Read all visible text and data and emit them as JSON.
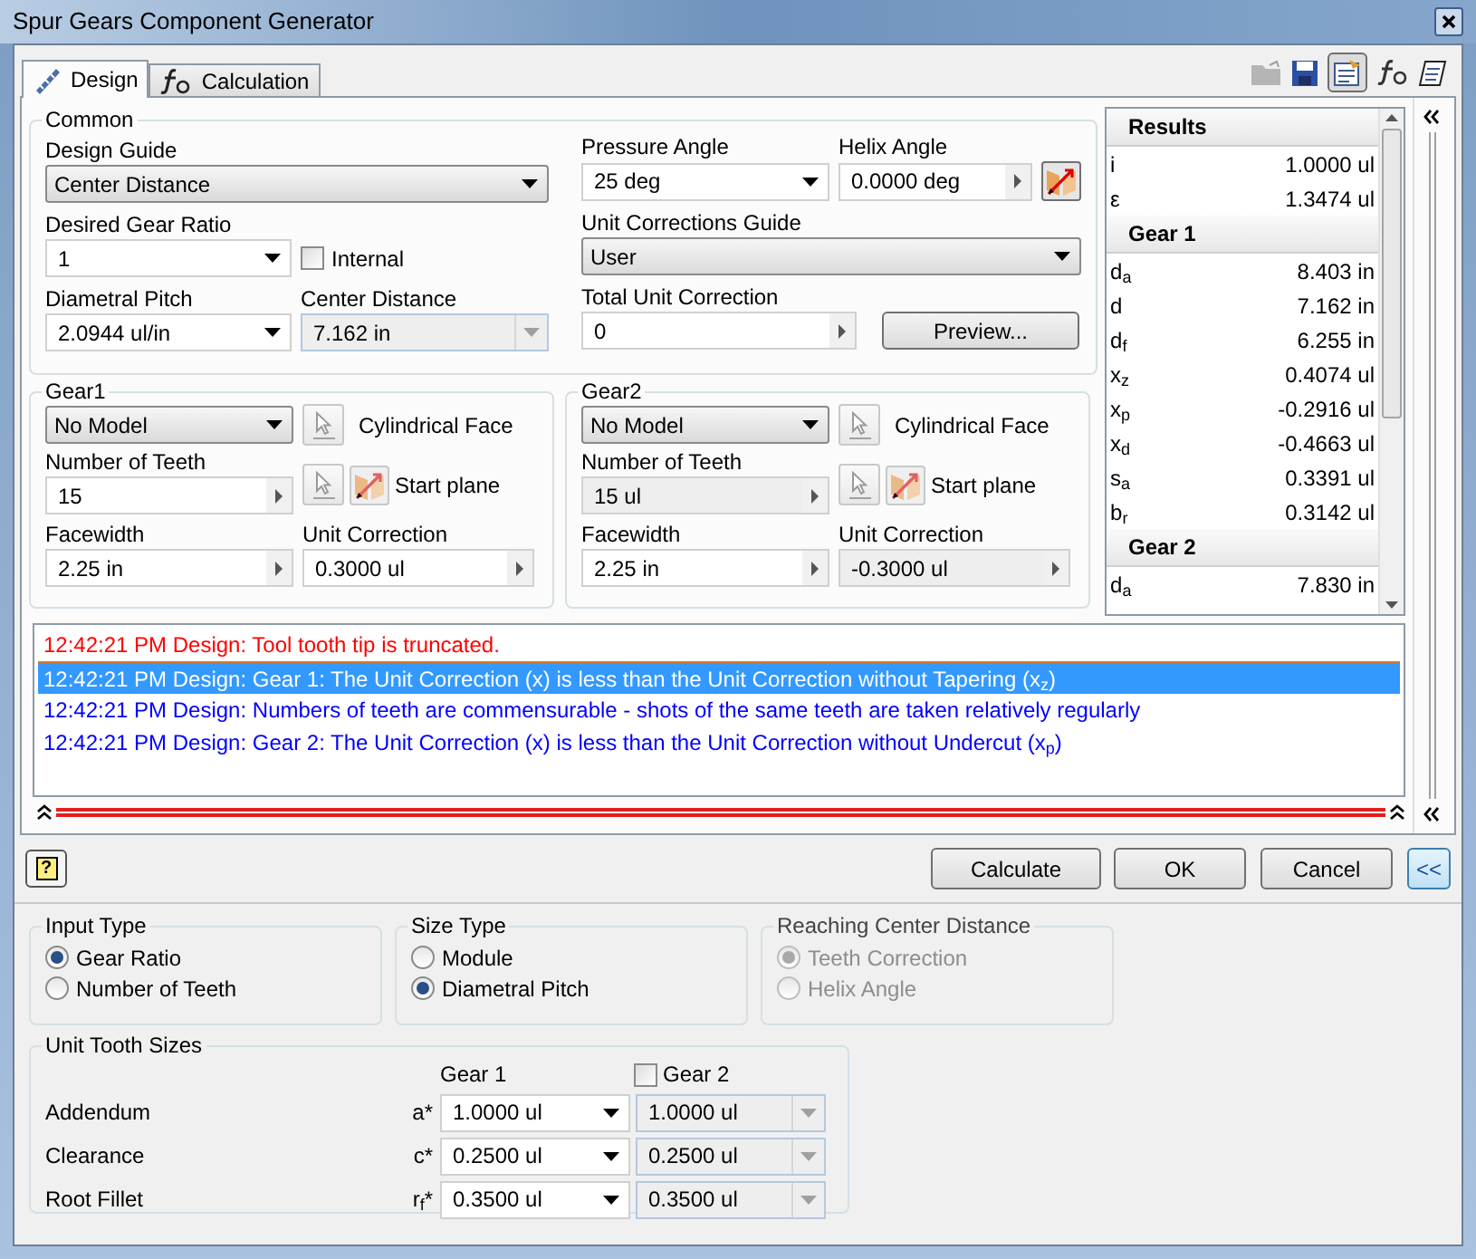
{
  "window": {
    "title": "Spur Gears Component Generator"
  },
  "tabs": [
    {
      "label": "Design",
      "selected": true
    },
    {
      "label": "Calculation",
      "selected": false
    }
  ],
  "common": {
    "title": "Common",
    "design_guide": {
      "label": "Design Guide",
      "value": "Center Distance"
    },
    "desired_gear_ratio": {
      "label": "Desired Gear Ratio",
      "value": "1"
    },
    "internal": {
      "label": "Internal",
      "checked": false
    },
    "diametral_pitch": {
      "label": "Diametral Pitch",
      "value": "2.0944 ul/in"
    },
    "center_distance": {
      "label": "Center Distance",
      "value": "7.162 in",
      "disabled": true
    },
    "pressure_angle": {
      "label": "Pressure Angle",
      "value": "25 deg"
    },
    "helix_angle": {
      "label": "Helix Angle",
      "value": "0.0000 deg"
    },
    "unit_corrections_guide": {
      "label": "Unit Corrections Guide",
      "value": "User"
    },
    "total_unit_correction": {
      "label": "Total Unit Correction",
      "value": "0"
    },
    "preview_button": "Preview..."
  },
  "gears": [
    {
      "title": "Gear1",
      "model": "No Model",
      "face_label": "Cylindrical Face",
      "plane_label": "Start plane",
      "teeth": {
        "label": "Number of Teeth",
        "value": "15",
        "disabled": false
      },
      "facewidth": {
        "label": "Facewidth",
        "value": "2.25 in"
      },
      "unit_correction": {
        "label": "Unit Correction",
        "value": "0.3000 ul",
        "disabled": false
      }
    },
    {
      "title": "Gear2",
      "model": "No Model",
      "face_label": "Cylindrical Face",
      "plane_label": "Start plane",
      "teeth": {
        "label": "Number of Teeth",
        "value": "15 ul",
        "disabled": true
      },
      "facewidth": {
        "label": "Facewidth",
        "value": "2.25 in"
      },
      "unit_correction": {
        "label": "Unit Correction",
        "value": "-0.3000 ul",
        "disabled": true
      }
    }
  ],
  "results": [
    {
      "kind": "header",
      "label": "Results"
    },
    {
      "kind": "value",
      "symbol": "i",
      "value": "1.0000 ul"
    },
    {
      "kind": "value",
      "symbol": "ε",
      "value": "1.3474 ul"
    },
    {
      "kind": "header",
      "label": "Gear 1"
    },
    {
      "kind": "value",
      "symbol": "d$_{a}$",
      "value": "8.403 in"
    },
    {
      "kind": "value",
      "symbol": "d",
      "value": "7.162 in"
    },
    {
      "kind": "value",
      "symbol": "d$_{f}$",
      "value": "6.255 in"
    },
    {
      "kind": "value",
      "symbol": "x$_{z}$",
      "value": "0.4074 ul"
    },
    {
      "kind": "value",
      "symbol": "x$_{p}$",
      "value": "-0.2916 ul"
    },
    {
      "kind": "value",
      "symbol": "x$_{d}$",
      "value": "-0.4663 ul"
    },
    {
      "kind": "value",
      "symbol": "s$_{a}$",
      "value": "0.3391 ul"
    },
    {
      "kind": "value",
      "symbol": "b$_{r}$",
      "value": "0.3142 ul"
    },
    {
      "kind": "header",
      "label": "Gear 2"
    },
    {
      "kind": "value",
      "symbol": "d$_{a}$",
      "value": "7.830 in"
    }
  ],
  "messages": [
    {
      "text": "12:42:21 PM Design: Tool tooth tip is truncated.",
      "color": "#ff0000",
      "selected": false
    },
    {
      "text": "12:42:21 PM Design: Gear 1: The Unit Correction (x) is less than the Unit Correction without Tapering (x$_{z}$)",
      "selected": true
    },
    {
      "text": "12:42:21 PM Design: Numbers of teeth are commensurable - shots of the same teeth are taken relatively regularly",
      "color": "#0000ff",
      "selected": false
    },
    {
      "text": "12:42:21 PM Design: Gear 2: The Unit Correction (x) is less than the Unit Correction without Undercut (x$_{p}$)",
      "color": "#0000ff",
      "selected": false
    }
  ],
  "buttons": {
    "help": "?",
    "calculate": "Calculate",
    "ok": "OK",
    "cancel": "Cancel",
    "more": "<<"
  },
  "option_groups": [
    {
      "title": "Input Type",
      "disabled": false,
      "options": [
        {
          "label": "Gear Ratio",
          "selected": true
        },
        {
          "label": "Number of Teeth",
          "selected": false
        }
      ]
    },
    {
      "title": "Size Type",
      "disabled": false,
      "options": [
        {
          "label": "Module",
          "selected": false
        },
        {
          "label": "Diametral Pitch",
          "selected": true
        }
      ]
    },
    {
      "title": "Reaching Center Distance",
      "disabled": true,
      "options": [
        {
          "label": "Teeth Correction",
          "selected": true
        },
        {
          "label": "Helix Angle",
          "selected": false
        }
      ]
    }
  ],
  "unit_tooth_sizes": {
    "title": "Unit Tooth Sizes",
    "gear1_header": "Gear 1",
    "gear2_header": {
      "label": "Gear 2",
      "checked": false
    },
    "rows": [
      {
        "label": "Addendum",
        "symbol": "a*",
        "gear1": "1.0000 ul",
        "gear2": "1.0000 ul"
      },
      {
        "label": "Clearance",
        "symbol": "c*",
        "gear1": "0.2500 ul",
        "gear2": "0.2500 ul"
      },
      {
        "label": "Root Fillet",
        "symbol": "r$_{f}$*",
        "gear1": "0.3500 ul",
        "gear2": "0.3500 ul"
      }
    ]
  }
}
